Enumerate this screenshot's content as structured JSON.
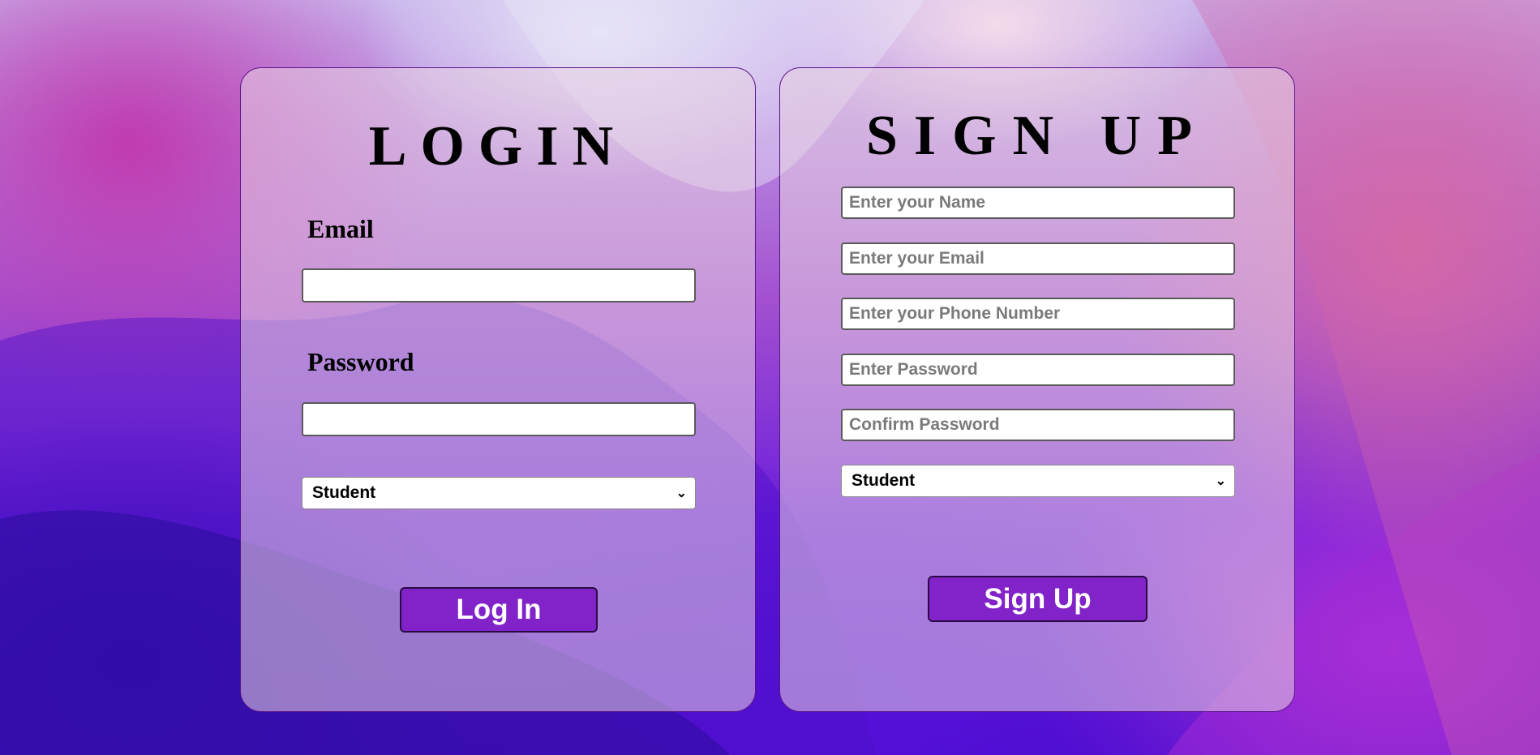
{
  "login": {
    "title": "LOGIN",
    "email_label": "Email",
    "email_value": "",
    "password_label": "Password",
    "password_value": "",
    "role_selected": "Student",
    "submit_label": "Log In"
  },
  "signup": {
    "title": "SIGN UP",
    "name_placeholder": "Enter your Name",
    "email_placeholder": "Enter your Email",
    "phone_placeholder": "Enter your Phone Number",
    "password_placeholder": "Enter Password",
    "confirm_placeholder": "Confirm Password",
    "role_selected": "Student",
    "submit_label": "Sign Up"
  },
  "icons": {
    "dropdown": "chevron-down-icon"
  },
  "colors": {
    "button_bg": "#8123c9",
    "card_border": "#5a1488"
  }
}
